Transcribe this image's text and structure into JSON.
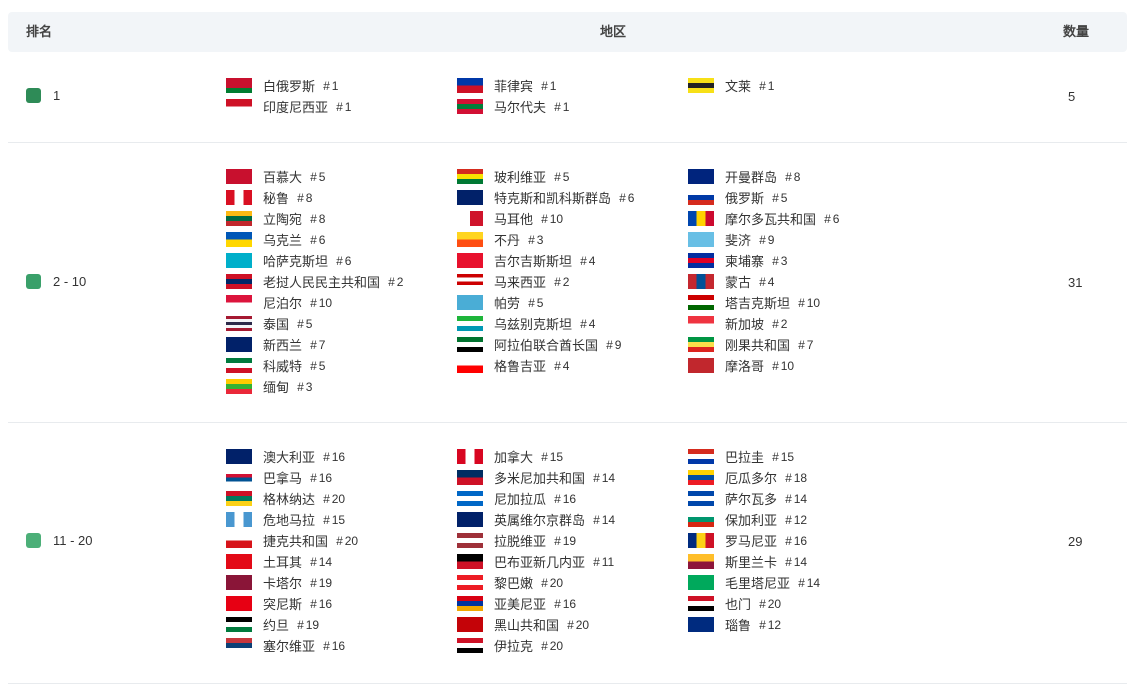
{
  "header": {
    "rank": "排名",
    "region": "地区",
    "count": "数量"
  },
  "groups": [
    {
      "rank": "1",
      "count": "5",
      "color": "#2e8b57",
      "columns": [
        [
          {
            "name": "白俄罗斯",
            "num": "1",
            "flag": [
              "#c8102e",
              "#c8102e",
              "#007c30"
            ]
          },
          {
            "name": "印度尼西亚",
            "num": "1",
            "flag": [
              "#ce1126",
              "#ffffff"
            ]
          }
        ],
        [
          {
            "name": "菲律宾",
            "num": "1",
            "flag": [
              "#0038a8",
              "#ce1126"
            ]
          },
          {
            "name": "马尔代夫",
            "num": "1",
            "flag": [
              "#d21034",
              "#007e3a",
              "#d21034"
            ]
          }
        ],
        [
          {
            "name": "文莱",
            "num": "1",
            "flag": [
              "#f7e017",
              "#222222",
              "#f7e017"
            ]
          }
        ]
      ]
    },
    {
      "rank": "2 - 10",
      "count": "31",
      "color": "#3aa06a",
      "columns": [
        [
          {
            "name": "百慕大",
            "num": "5",
            "flag": [
              "#c8102e",
              "#c8102e"
            ]
          },
          {
            "name": "秘鲁",
            "num": "8",
            "flag": [
              "#d91023",
              "#ffffff",
              "#d91023"
            ],
            "v": true
          },
          {
            "name": "立陶宛",
            "num": "8",
            "flag": [
              "#fdb913",
              "#006a44",
              "#c1272d"
            ]
          },
          {
            "name": "乌克兰",
            "num": "6",
            "flag": [
              "#0057b7",
              "#ffd700"
            ]
          },
          {
            "name": "哈萨克斯坦",
            "num": "6",
            "flag": [
              "#00afca",
              "#00afca"
            ]
          },
          {
            "name": "老挝人民民主共和国",
            "num": "2",
            "flag": [
              "#ce1126",
              "#002868",
              "#ce1126"
            ]
          },
          {
            "name": "尼泊尔",
            "num": "10",
            "flag": [
              "#dc143c",
              "#ffffff"
            ]
          },
          {
            "name": "泰国",
            "num": "5",
            "flag": [
              "#a51931",
              "#f4f5f8",
              "#2d2a4a",
              "#f4f5f8",
              "#a51931"
            ]
          },
          {
            "name": "新西兰",
            "num": "7",
            "flag": [
              "#012169",
              "#012169"
            ]
          },
          {
            "name": "科威特",
            "num": "5",
            "flag": [
              "#007a3d",
              "#ffffff",
              "#ce1126"
            ]
          },
          {
            "name": "缅甸",
            "num": "3",
            "flag": [
              "#fecb00",
              "#34b233",
              "#ea2839"
            ]
          }
        ],
        [
          {
            "name": "玻利维亚",
            "num": "5",
            "flag": [
              "#d52b1e",
              "#f9e300",
              "#007934"
            ]
          },
          {
            "name": "特克斯和凯科斯群岛",
            "num": "6",
            "flag": [
              "#012169",
              "#012169"
            ]
          },
          {
            "name": "马耳他",
            "num": "10",
            "flag": [
              "#ffffff",
              "#cf142b"
            ],
            "v": true
          },
          {
            "name": "不丹",
            "num": "3",
            "flag": [
              "#ffd520",
              "#ff4e12"
            ]
          },
          {
            "name": "吉尔吉斯斯坦",
            "num": "4",
            "flag": [
              "#e8112d",
              "#e8112d"
            ]
          },
          {
            "name": "马来西亚",
            "num": "2",
            "flag": [
              "#cc0001",
              "#ffffff",
              "#cc0001",
              "#ffffff"
            ]
          },
          {
            "name": "帕劳",
            "num": "5",
            "flag": [
              "#4aadd6",
              "#4aadd6"
            ]
          },
          {
            "name": "乌兹别克斯坦",
            "num": "4",
            "flag": [
              "#1eb53a",
              "#ffffff",
              "#0099b5"
            ]
          },
          {
            "name": "阿拉伯联合酋长国",
            "num": "9",
            "flag": [
              "#00732f",
              "#ffffff",
              "#000000"
            ]
          },
          {
            "name": "格鲁吉亚",
            "num": "4",
            "flag": [
              "#ffffff",
              "#ff0000"
            ]
          }
        ],
        [
          {
            "name": "开曼群岛",
            "num": "8",
            "flag": [
              "#00247d",
              "#00247d"
            ]
          },
          {
            "name": "俄罗斯",
            "num": "5",
            "flag": [
              "#ffffff",
              "#0039a6",
              "#d52b1e"
            ]
          },
          {
            "name": "摩尔多瓦共和国",
            "num": "6",
            "flag": [
              "#0046ae",
              "#ffd200",
              "#cc092f"
            ],
            "v": true
          },
          {
            "name": "斐济",
            "num": "9",
            "flag": [
              "#68bfe5",
              "#68bfe5"
            ]
          },
          {
            "name": "柬埔寨",
            "num": "3",
            "flag": [
              "#032ea1",
              "#e00025",
              "#032ea1"
            ]
          },
          {
            "name": "蒙古",
            "num": "4",
            "flag": [
              "#c4272f",
              "#015197",
              "#c4272f"
            ],
            "v": true
          },
          {
            "name": "塔吉克斯坦",
            "num": "10",
            "flag": [
              "#cc0000",
              "#ffffff",
              "#006600"
            ]
          },
          {
            "name": "新加坡",
            "num": "2",
            "flag": [
              "#ef3340",
              "#ffffff"
            ]
          },
          {
            "name": "刚果共和国",
            "num": "7",
            "flag": [
              "#009543",
              "#fbde4a",
              "#dc241f"
            ]
          },
          {
            "name": "摩洛哥",
            "num": "10",
            "flag": [
              "#c1272d",
              "#c1272d"
            ]
          }
        ]
      ]
    },
    {
      "rank": "11 - 20",
      "count": "29",
      "color": "#4caf78",
      "columns": [
        [
          {
            "name": "澳大利亚",
            "num": "16",
            "flag": [
              "#012169",
              "#012169"
            ]
          },
          {
            "name": "巴拿马",
            "num": "16",
            "flag": [
              "#ffffff",
              "#d21034",
              "#005293",
              "#ffffff"
            ]
          },
          {
            "name": "格林纳达",
            "num": "20",
            "flag": [
              "#ce1126",
              "#007a5e",
              "#fcd116"
            ]
          },
          {
            "name": "危地马拉",
            "num": "15",
            "flag": [
              "#4997d0",
              "#ffffff",
              "#4997d0"
            ],
            "v": true
          },
          {
            "name": "捷克共和国",
            "num": "20",
            "flag": [
              "#ffffff",
              "#d7141a"
            ]
          },
          {
            "name": "土耳其",
            "num": "14",
            "flag": [
              "#e30a17",
              "#e30a17"
            ]
          },
          {
            "name": "卡塔尔",
            "num": "19",
            "flag": [
              "#8a1538",
              "#8a1538"
            ]
          },
          {
            "name": "突尼斯",
            "num": "16",
            "flag": [
              "#e70013",
              "#e70013"
            ]
          },
          {
            "name": "约旦",
            "num": "19",
            "flag": [
              "#000000",
              "#ffffff",
              "#007a3d"
            ]
          },
          {
            "name": "塞尔维亚",
            "num": "16",
            "flag": [
              "#c6363c",
              "#0c4076",
              "#ffffff"
            ]
          }
        ],
        [
          {
            "name": "加拿大",
            "num": "15",
            "flag": [
              "#d80621",
              "#ffffff",
              "#d80621"
            ],
            "v": true
          },
          {
            "name": "多米尼加共和国",
            "num": "14",
            "flag": [
              "#002d62",
              "#ce1126"
            ]
          },
          {
            "name": "尼加拉瓜",
            "num": "16",
            "flag": [
              "#0067c6",
              "#ffffff",
              "#0067c6"
            ]
          },
          {
            "name": "英属维尔京群岛",
            "num": "14",
            "flag": [
              "#012169",
              "#012169"
            ]
          },
          {
            "name": "拉脱维亚",
            "num": "19",
            "flag": [
              "#9e3039",
              "#ffffff",
              "#9e3039"
            ]
          },
          {
            "name": "巴布亚新几内亚",
            "num": "11",
            "flag": [
              "#000000",
              "#ce1126"
            ]
          },
          {
            "name": "黎巴嫩",
            "num": "20",
            "flag": [
              "#ed1c24",
              "#ffffff",
              "#ed1c24"
            ]
          },
          {
            "name": "亚美尼亚",
            "num": "16",
            "flag": [
              "#d90012",
              "#0033a0",
              "#f2a800"
            ]
          },
          {
            "name": "黑山共和国",
            "num": "20",
            "flag": [
              "#c40308",
              "#c40308"
            ]
          },
          {
            "name": "伊拉克",
            "num": "20",
            "flag": [
              "#ce1126",
              "#ffffff",
              "#000000"
            ]
          }
        ],
        [
          {
            "name": "巴拉圭",
            "num": "15",
            "flag": [
              "#d52b1e",
              "#ffffff",
              "#0038a8"
            ]
          },
          {
            "name": "厄瓜多尔",
            "num": "18",
            "flag": [
              "#ffd100",
              "#034ea2",
              "#ed1c24"
            ]
          },
          {
            "name": "萨尔瓦多",
            "num": "14",
            "flag": [
              "#0047ab",
              "#ffffff",
              "#0047ab"
            ]
          },
          {
            "name": "保加利亚",
            "num": "12",
            "flag": [
              "#ffffff",
              "#00966e",
              "#d62612"
            ]
          },
          {
            "name": "罗马尼亚",
            "num": "16",
            "flag": [
              "#002b7f",
              "#fcd116",
              "#ce1126"
            ],
            "v": true
          },
          {
            "name": "斯里兰卡",
            "num": "14",
            "flag": [
              "#ffbe29",
              "#8d153a"
            ]
          },
          {
            "name": "毛里塔尼亚",
            "num": "14",
            "flag": [
              "#00a95c",
              "#00a95c"
            ]
          },
          {
            "name": "也门",
            "num": "20",
            "flag": [
              "#ce1126",
              "#ffffff",
              "#000000"
            ]
          },
          {
            "name": "瑙鲁",
            "num": "12",
            "flag": [
              "#002b7f",
              "#002b7f"
            ]
          }
        ]
      ]
    }
  ]
}
